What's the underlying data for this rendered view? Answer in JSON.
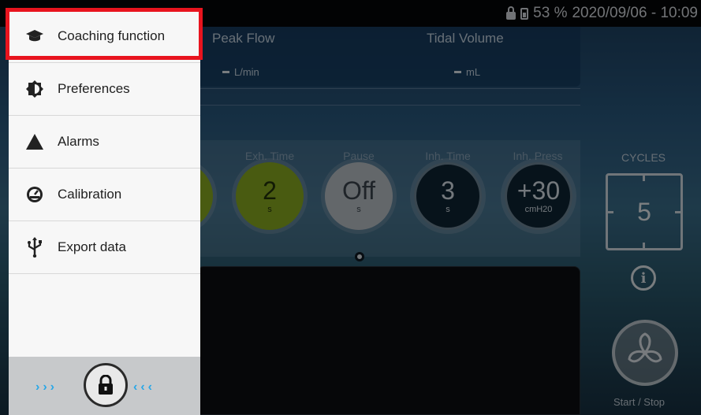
{
  "status_bar": {
    "battery": "53 %",
    "datetime": "2020/09/06 - 10:09"
  },
  "measurements": {
    "peak_flow": {
      "label": "Peak Flow",
      "unit": "L/min"
    },
    "tidal_volume": {
      "label": "Tidal Volume",
      "unit": "mL"
    }
  },
  "parameters": [
    {
      "label": "Exh. Time",
      "value": "2",
      "unit": "s",
      "style": "green"
    },
    {
      "label": "Pause",
      "value": "Off",
      "unit": "s",
      "style": "grey"
    },
    {
      "label": "Inh. Time",
      "value": "3",
      "unit": "s",
      "style": "dark"
    },
    {
      "label": "Inh. Press",
      "value": "+30",
      "unit": "cmH20",
      "style": "dark"
    }
  ],
  "cycles": {
    "label": "CYCLES",
    "value": "5"
  },
  "start_stop": {
    "label": "Start / Stop"
  },
  "drawer": {
    "items": [
      {
        "label": "Coaching function",
        "icon": "graduation-cap-icon"
      },
      {
        "label": "Preferences",
        "icon": "preferences-icon"
      },
      {
        "label": "Alarms",
        "icon": "alarm-triangle-icon"
      },
      {
        "label": "Calibration",
        "icon": "gauge-icon"
      },
      {
        "label": "Export data",
        "icon": "usb-icon"
      }
    ]
  },
  "colors": {
    "highlight": "#e8141e",
    "dial_green": "#8cae22",
    "chevron": "#2aa7e6"
  }
}
